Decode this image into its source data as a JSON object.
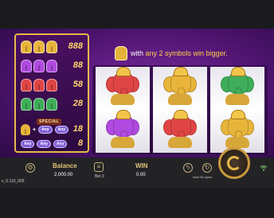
{
  "paytable": {
    "rows": [
      {
        "symbol": "gold-ganesha",
        "color": "#e8b53a",
        "payout": "888"
      },
      {
        "symbol": "purple-ganesha",
        "color": "#b04ae0",
        "payout": "88"
      },
      {
        "symbol": "red-ganesha",
        "color": "#e04545",
        "payout": "58"
      },
      {
        "symbol": "green-ganesha",
        "color": "#3fae5a",
        "payout": "28"
      }
    ],
    "special": {
      "label": "SPECIAL",
      "any_label": "Any",
      "plus": "+",
      "gold_payout": "18",
      "any3_payout": "8"
    }
  },
  "banner": {
    "text_prefix": "with",
    "text_highlight": "any 2 symbols win bigger."
  },
  "reels": [
    [
      "red-ganesha",
      "purple-ganesha"
    ],
    [
      "gold-ganesha",
      "red-ganesha"
    ],
    [
      "green-ganesha",
      "gold-ganesha"
    ]
  ],
  "symbol_colors": {
    "red-ganesha": "#e04545",
    "purple-ganesha": "#b04ae0",
    "gold-ganesha": "#e8b53a",
    "green-ganesha": "#3fae5a"
  },
  "controls": {
    "balance_label": "Balance",
    "balance_value": "2,000.00",
    "bet_label": "Bet 3",
    "win_label": "WIN",
    "win_value": "0.00",
    "next_auto_label": "Next 50 spins"
  },
  "version": "v_0.110_005"
}
